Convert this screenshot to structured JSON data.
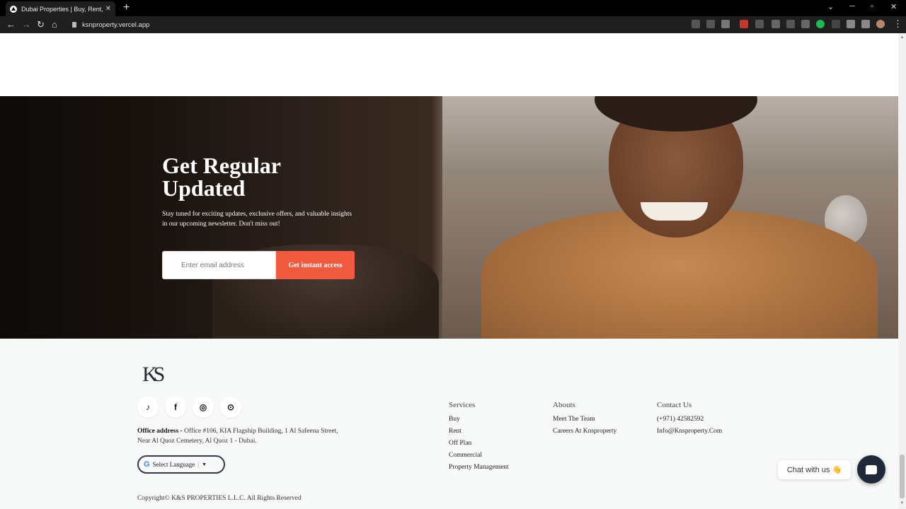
{
  "browser": {
    "tab_title": "Dubai Properties | Buy, Rent, and",
    "tab_close": "✕",
    "new_tab": "+",
    "url": "ksnproperty.vercel.app"
  },
  "hero": {
    "title_line1": "Get Regular",
    "title_line2": "Updated",
    "description": "Stay tuned for exciting updates, exclusive offers, and valuable insights in our upcoming newsletter. Don't miss out!",
    "email_placeholder": "Enter email address",
    "cta_label": "Get instant access"
  },
  "footer": {
    "logo_text": "KS",
    "socials": [
      {
        "icon": "tiktok-icon",
        "glyph": "♪"
      },
      {
        "icon": "facebook-icon",
        "glyph": "f"
      },
      {
        "icon": "instagram-icon",
        "glyph": "◎"
      },
      {
        "icon": "location-pin-icon",
        "glyph": "⊙"
      }
    ],
    "office_label": "Office address -",
    "office_address": "Office #106, KIA Flagship Building, 1 Al Safeena Street, Near Al Quoz Cemetery, Al Quoz 1 - Dubai.",
    "language_g": "G",
    "language_label": "Select Language",
    "language_arrow": "▼",
    "copyright": "Copyright© K&S PROPERTIES L.L.C. All Rights Reserved",
    "services": {
      "heading": "Services",
      "links": [
        "Buy",
        "Rent",
        "Off Plan",
        "Commercial",
        "Property Management"
      ]
    },
    "abouts": {
      "heading": "Abouts",
      "links": [
        "Meet The Team",
        "Careers At Knsproperty"
      ]
    },
    "contact": {
      "heading": "Contact Us",
      "links": [
        "(+971) 42582592",
        "Info@Knsproperty.Com"
      ]
    }
  },
  "chat": {
    "bubble_label": "Chat with us 👋"
  },
  "colors": {
    "accent": "#f05a3f",
    "chat_button": "#1e2a3a"
  }
}
